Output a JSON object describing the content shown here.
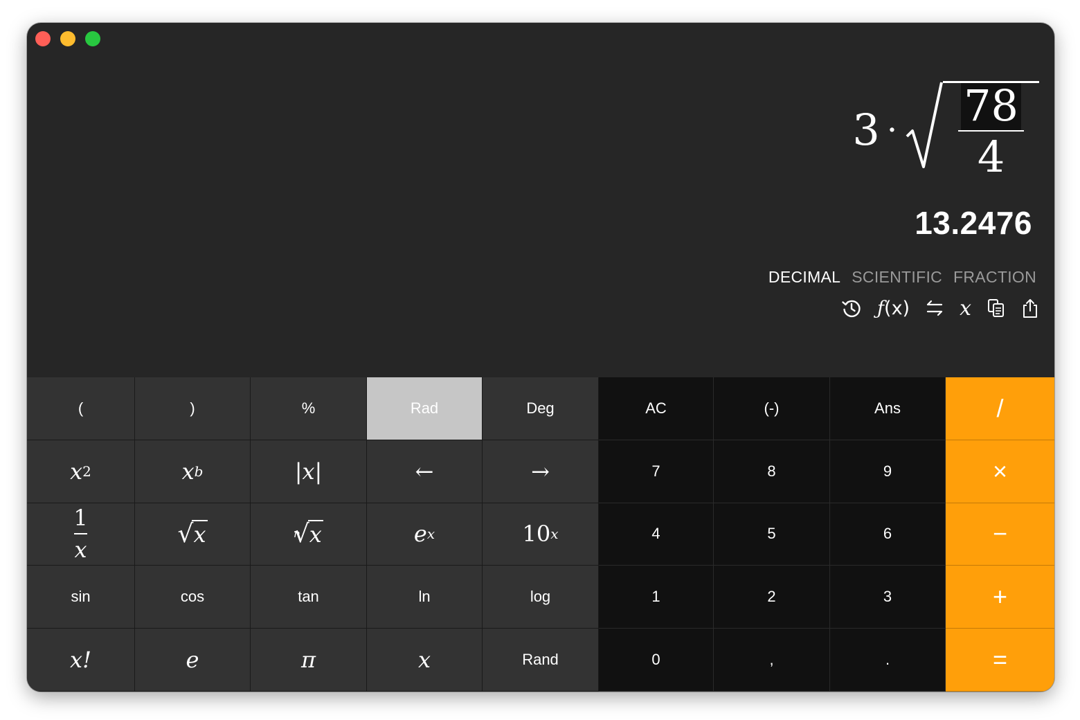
{
  "window": {
    "buttons": [
      "close",
      "minimize",
      "zoom"
    ]
  },
  "display": {
    "expression": {
      "multiplier": "3",
      "dot": "·",
      "numerator": "78",
      "denominator": "4"
    },
    "result": "13.2476",
    "modes": [
      {
        "label": "DECIMAL",
        "active": true
      },
      {
        "label": "SCIENTIFIC",
        "active": false
      },
      {
        "label": "FRACTION",
        "active": false
      }
    ],
    "tools": {
      "history_icon": "history-icon",
      "function_label": "(x)",
      "function_glyph": "ƒ",
      "convert_icon": "convert-arrows-icon",
      "variable_label": "x",
      "copy_icon": "copy-icon",
      "share_icon": "share-icon"
    }
  },
  "keys": {
    "row1": {
      "lparen": "(",
      "rparen": ")",
      "percent": "%",
      "rad": "Rad",
      "deg": "Deg",
      "ac": "AC",
      "negate": "(-)",
      "ans": "Ans",
      "divide": "/"
    },
    "row2": {
      "x": "x",
      "two": "2",
      "b": "b",
      "abs": "|x|",
      "left": "←",
      "right": "→",
      "seven": "7",
      "eight": "8",
      "nine": "9",
      "multiply": "×"
    },
    "row3": {
      "one": "1",
      "e": "e",
      "ten": "10",
      "four": "4",
      "five": "5",
      "six": "6",
      "minus": "−"
    },
    "row4": {
      "sin": "sin",
      "cos": "cos",
      "tan": "tan",
      "ln": "ln",
      "log": "log",
      "one": "1",
      "two": "2",
      "three": "3",
      "plus": "+"
    },
    "row5": {
      "factorial": "x!",
      "e_const": "e",
      "pi": "π",
      "var_x": "x",
      "rand": "Rand",
      "zero": "0",
      "comma": ",",
      "period": ".",
      "equals": "="
    }
  },
  "angle_mode": "Rad",
  "colors": {
    "accent": "#ff9f0a",
    "function_key": "#333333",
    "number_key": "#111111",
    "selected_key": "#c6c6c6",
    "background": "#262626"
  }
}
